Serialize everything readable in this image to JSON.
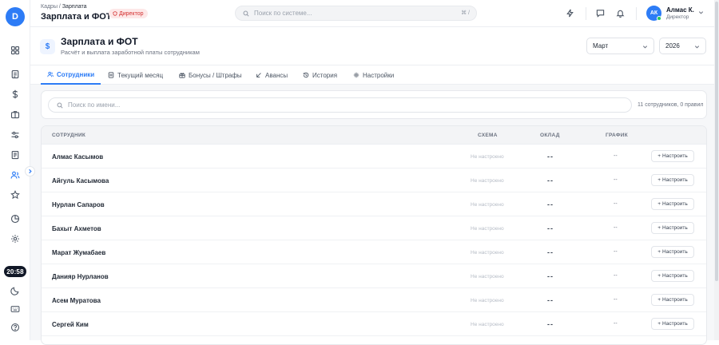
{
  "sidebar": {
    "logo_letter": "D",
    "clock": "20:58",
    "items": [
      "dashboard-icon",
      "document-icon",
      "dollar-icon",
      "briefcase-icon",
      "sliders-icon",
      "receipt-icon",
      "users-icon",
      "star-icon",
      "chart-pie-icon",
      "gear-icon",
      "moon-icon",
      "keyboard-icon",
      "help-icon"
    ]
  },
  "topbar": {
    "breadcrumb_parent": "Кадры",
    "breadcrumb_sep": " / ",
    "breadcrumb_current": "Зарплата",
    "page_title": "Зарплата и ФОТ",
    "role_badge": "Директор",
    "search_placeholder": "Поиск по системе...",
    "search_shortcut": "⌘ /",
    "user_initials": "АК",
    "user_name": "Алмас К.",
    "user_role": "Директор"
  },
  "header": {
    "icon": "$",
    "title": "Зарплата и ФОТ",
    "subtitle": "Расчёт и выплата заработной платы сотрудникам",
    "month": "Март",
    "year": "2026"
  },
  "tabs": [
    {
      "label": "Сотрудники",
      "icon": "users-icon",
      "active": true
    },
    {
      "label": "Текущий месяц",
      "icon": "calendar-doc-icon",
      "active": false
    },
    {
      "label": "Бонусы / Штрафы",
      "icon": "gift-icon",
      "active": false
    },
    {
      "label": "Авансы",
      "icon": "arrow-down-left-icon",
      "active": false
    },
    {
      "label": "История",
      "icon": "history-icon",
      "active": false
    },
    {
      "label": "Настройки",
      "icon": "gear-icon",
      "active": false
    }
  ],
  "employees": {
    "search_placeholder": "Поиск по имени...",
    "count_text": "11 сотрудников, 0 правил",
    "columns": {
      "employee": "СОТРУДНИК",
      "scheme": "СХЕМА",
      "salary": "ОКЛАД",
      "schedule": "ГРАФИК"
    },
    "rows": [
      {
        "name": "Алмас Касымов",
        "scheme": "Не настроено",
        "salary": "--",
        "schedule": "--",
        "action": "Настроить"
      },
      {
        "name": "Айгуль Касымова",
        "scheme": "Не настроено",
        "salary": "--",
        "schedule": "--",
        "action": "Настроить"
      },
      {
        "name": "Нурлан Сапаров",
        "scheme": "Не настроено",
        "salary": "--",
        "schedule": "--",
        "action": "Настроить"
      },
      {
        "name": "Бахыт Ахметов",
        "scheme": "Не настроено",
        "salary": "--",
        "schedule": "--",
        "action": "Настроить"
      },
      {
        "name": "Марат Жумабаев",
        "scheme": "Не настроено",
        "salary": "--",
        "schedule": "--",
        "action": "Настроить"
      },
      {
        "name": "Данияр Нурланов",
        "scheme": "Не настроено",
        "salary": "--",
        "schedule": "--",
        "action": "Настроить"
      },
      {
        "name": "Асем Муратова",
        "scheme": "Не настроено",
        "salary": "--",
        "schedule": "--",
        "action": "Настроить"
      },
      {
        "name": "Сергей Ким",
        "scheme": "Не настроено",
        "salary": "--",
        "schedule": "--",
        "action": "Настроить"
      }
    ]
  },
  "colors": {
    "accent": "#2d7cf6",
    "badge_bg": "#fde8e8",
    "badge_text": "#d32f2f",
    "online": "#22c55e"
  }
}
